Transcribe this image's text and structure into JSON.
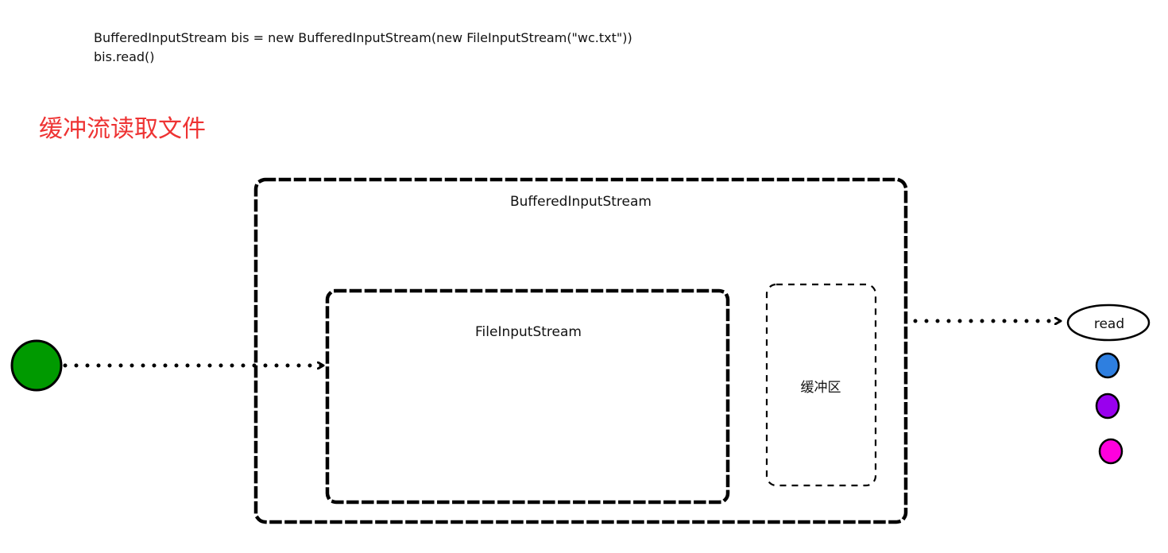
{
  "code": {
    "line1": "BufferedInputStream bis = new BufferedInputStream(new FileInputStream(\"wc.txt\"))",
    "line2": "bis.read()"
  },
  "heading": "缓冲流读取文件",
  "diagram": {
    "outer_box_label": "BufferedInputStream",
    "inner_box_label": "FileInputStream",
    "buffer_label": "缓冲区",
    "read_label": "read",
    "source_color": "#009a00",
    "dot_colors": [
      "#2e7fe0",
      "#9900ee",
      "#ff00dd"
    ]
  }
}
